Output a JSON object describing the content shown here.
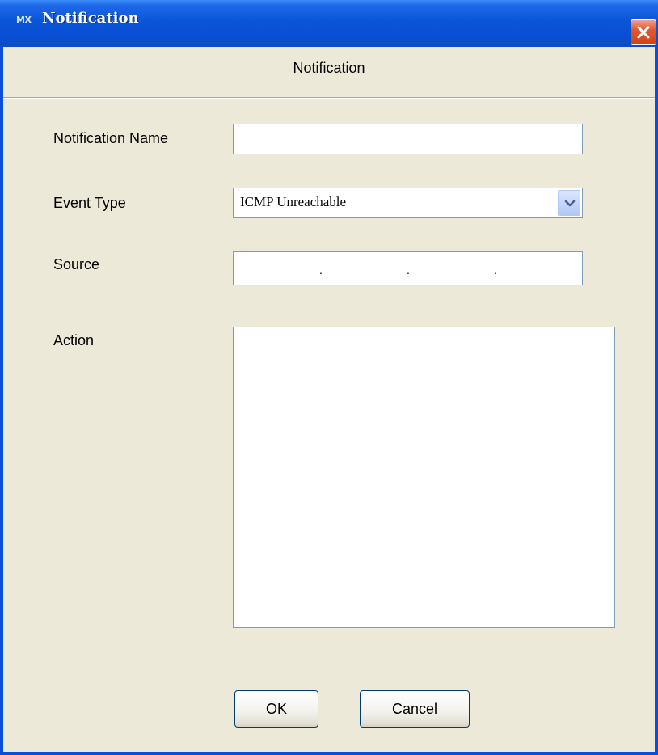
{
  "window": {
    "title": "Notification",
    "icon_text": "MX",
    "icon_name": "app-logo-icon",
    "close_icon": "close-icon"
  },
  "header": {
    "label": "Notification"
  },
  "form": {
    "notification_name": {
      "label": "Notification Name",
      "value": ""
    },
    "event_type": {
      "label": "Event Type",
      "selected": "ICMP Unreachable",
      "arrow_icon": "chevron-down-icon"
    },
    "source": {
      "label": "Source",
      "dots": [
        ".",
        ".",
        "."
      ]
    },
    "action": {
      "label": "Action",
      "value": ""
    }
  },
  "buttons": {
    "ok": "OK",
    "cancel": "Cancel"
  },
  "colors": {
    "titlebar": "#0a4fd6",
    "client_bg": "#ece9d8",
    "field_border": "#7f9db9",
    "close_button": "#d2411b"
  }
}
